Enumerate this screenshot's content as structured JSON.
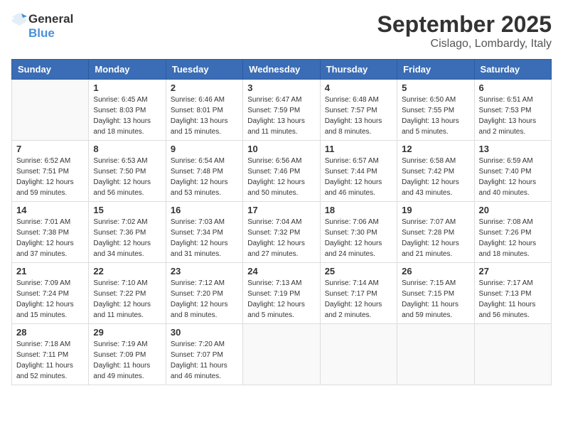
{
  "header": {
    "logo_general": "General",
    "logo_blue": "Blue",
    "month_title": "September 2025",
    "location": "Cislago, Lombardy, Italy"
  },
  "days_of_week": [
    "Sunday",
    "Monday",
    "Tuesday",
    "Wednesday",
    "Thursday",
    "Friday",
    "Saturday"
  ],
  "weeks": [
    [
      {
        "day": "",
        "info": ""
      },
      {
        "day": "1",
        "info": "Sunrise: 6:45 AM\nSunset: 8:03 PM\nDaylight: 13 hours\nand 18 minutes."
      },
      {
        "day": "2",
        "info": "Sunrise: 6:46 AM\nSunset: 8:01 PM\nDaylight: 13 hours\nand 15 minutes."
      },
      {
        "day": "3",
        "info": "Sunrise: 6:47 AM\nSunset: 7:59 PM\nDaylight: 13 hours\nand 11 minutes."
      },
      {
        "day": "4",
        "info": "Sunrise: 6:48 AM\nSunset: 7:57 PM\nDaylight: 13 hours\nand 8 minutes."
      },
      {
        "day": "5",
        "info": "Sunrise: 6:50 AM\nSunset: 7:55 PM\nDaylight: 13 hours\nand 5 minutes."
      },
      {
        "day": "6",
        "info": "Sunrise: 6:51 AM\nSunset: 7:53 PM\nDaylight: 13 hours\nand 2 minutes."
      }
    ],
    [
      {
        "day": "7",
        "info": "Sunrise: 6:52 AM\nSunset: 7:51 PM\nDaylight: 12 hours\nand 59 minutes."
      },
      {
        "day": "8",
        "info": "Sunrise: 6:53 AM\nSunset: 7:50 PM\nDaylight: 12 hours\nand 56 minutes."
      },
      {
        "day": "9",
        "info": "Sunrise: 6:54 AM\nSunset: 7:48 PM\nDaylight: 12 hours\nand 53 minutes."
      },
      {
        "day": "10",
        "info": "Sunrise: 6:56 AM\nSunset: 7:46 PM\nDaylight: 12 hours\nand 50 minutes."
      },
      {
        "day": "11",
        "info": "Sunrise: 6:57 AM\nSunset: 7:44 PM\nDaylight: 12 hours\nand 46 minutes."
      },
      {
        "day": "12",
        "info": "Sunrise: 6:58 AM\nSunset: 7:42 PM\nDaylight: 12 hours\nand 43 minutes."
      },
      {
        "day": "13",
        "info": "Sunrise: 6:59 AM\nSunset: 7:40 PM\nDaylight: 12 hours\nand 40 minutes."
      }
    ],
    [
      {
        "day": "14",
        "info": "Sunrise: 7:01 AM\nSunset: 7:38 PM\nDaylight: 12 hours\nand 37 minutes."
      },
      {
        "day": "15",
        "info": "Sunrise: 7:02 AM\nSunset: 7:36 PM\nDaylight: 12 hours\nand 34 minutes."
      },
      {
        "day": "16",
        "info": "Sunrise: 7:03 AM\nSunset: 7:34 PM\nDaylight: 12 hours\nand 31 minutes."
      },
      {
        "day": "17",
        "info": "Sunrise: 7:04 AM\nSunset: 7:32 PM\nDaylight: 12 hours\nand 27 minutes."
      },
      {
        "day": "18",
        "info": "Sunrise: 7:06 AM\nSunset: 7:30 PM\nDaylight: 12 hours\nand 24 minutes."
      },
      {
        "day": "19",
        "info": "Sunrise: 7:07 AM\nSunset: 7:28 PM\nDaylight: 12 hours\nand 21 minutes."
      },
      {
        "day": "20",
        "info": "Sunrise: 7:08 AM\nSunset: 7:26 PM\nDaylight: 12 hours\nand 18 minutes."
      }
    ],
    [
      {
        "day": "21",
        "info": "Sunrise: 7:09 AM\nSunset: 7:24 PM\nDaylight: 12 hours\nand 15 minutes."
      },
      {
        "day": "22",
        "info": "Sunrise: 7:10 AM\nSunset: 7:22 PM\nDaylight: 12 hours\nand 11 minutes."
      },
      {
        "day": "23",
        "info": "Sunrise: 7:12 AM\nSunset: 7:20 PM\nDaylight: 12 hours\nand 8 minutes."
      },
      {
        "day": "24",
        "info": "Sunrise: 7:13 AM\nSunset: 7:19 PM\nDaylight: 12 hours\nand 5 minutes."
      },
      {
        "day": "25",
        "info": "Sunrise: 7:14 AM\nSunset: 7:17 PM\nDaylight: 12 hours\nand 2 minutes."
      },
      {
        "day": "26",
        "info": "Sunrise: 7:15 AM\nSunset: 7:15 PM\nDaylight: 11 hours\nand 59 minutes."
      },
      {
        "day": "27",
        "info": "Sunrise: 7:17 AM\nSunset: 7:13 PM\nDaylight: 11 hours\nand 56 minutes."
      }
    ],
    [
      {
        "day": "28",
        "info": "Sunrise: 7:18 AM\nSunset: 7:11 PM\nDaylight: 11 hours\nand 52 minutes."
      },
      {
        "day": "29",
        "info": "Sunrise: 7:19 AM\nSunset: 7:09 PM\nDaylight: 11 hours\nand 49 minutes."
      },
      {
        "day": "30",
        "info": "Sunrise: 7:20 AM\nSunset: 7:07 PM\nDaylight: 11 hours\nand 46 minutes."
      },
      {
        "day": "",
        "info": ""
      },
      {
        "day": "",
        "info": ""
      },
      {
        "day": "",
        "info": ""
      },
      {
        "day": "",
        "info": ""
      }
    ]
  ]
}
